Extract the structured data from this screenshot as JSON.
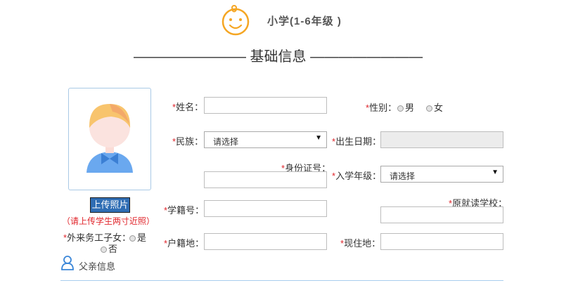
{
  "header": {
    "level_title": "小学(1-6年级 )",
    "section_title": "———————— 基础信息 ————————"
  },
  "photo": {
    "upload_label": "上传照片",
    "hint": "（请上传学生两寸近照）"
  },
  "migrant": {
    "label": "外来务工子女：",
    "options": [
      "是",
      "否"
    ]
  },
  "form": {
    "name_label": "姓名：",
    "gender_label": "性别：",
    "gender_options": [
      "男",
      "女"
    ],
    "ethnicity_label": "民族：",
    "ethnicity_value": "请选择",
    "birthdate_label": "出生日期：",
    "idcard_label": "身份证号：",
    "grade_label": "入学年级：",
    "grade_value": "请选择",
    "student_no_label": "学籍号：",
    "prev_school_label": "原就读学校：",
    "household_label": "户籍地：",
    "residence_label": "现住地："
  },
  "father": {
    "title": "父亲信息"
  },
  "colors": {
    "required": "#e0252b",
    "face_orange": "#f5a623",
    "upload_button": "#2f6db4"
  }
}
